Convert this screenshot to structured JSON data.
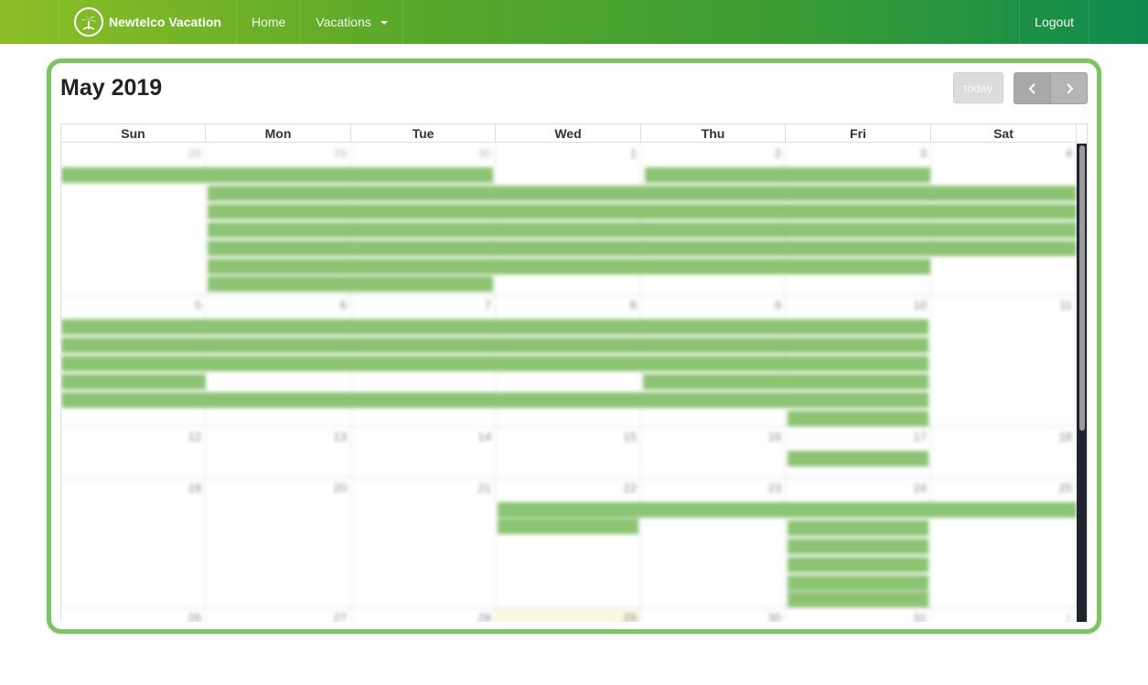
{
  "navbar": {
    "brand": "Newtelco Vacation",
    "items": [
      {
        "label": "Home"
      },
      {
        "label": "Vacations"
      }
    ],
    "logout": "Logout",
    "colors": {
      "start": "#8cbf26",
      "end": "#0e8a4e"
    }
  },
  "calendar": {
    "title": "May 2019",
    "today_label": "today",
    "prev_icon": "chevron-left-icon",
    "next_icon": "chevron-right-icon",
    "weekdays": [
      "Sun",
      "Mon",
      "Tue",
      "Wed",
      "Thu",
      "Fri",
      "Sat"
    ],
    "accent_color": "#82c266",
    "event_color": "#8cc474",
    "weeks": [
      {
        "days": [
          "28",
          "29",
          "30",
          "1",
          "2",
          "3",
          "4"
        ],
        "dim": [
          true,
          true,
          true,
          false,
          false,
          false,
          false
        ]
      },
      {
        "days": [
          "5",
          "6",
          "7",
          "8",
          "9",
          "10",
          "11"
        ],
        "dim": [
          false,
          false,
          false,
          false,
          false,
          false,
          false
        ]
      },
      {
        "days": [
          "12",
          "13",
          "14",
          "15",
          "16",
          "17",
          "18"
        ],
        "dim": [
          false,
          false,
          false,
          false,
          false,
          false,
          false
        ]
      },
      {
        "days": [
          "19",
          "20",
          "21",
          "22",
          "23",
          "24",
          "25"
        ],
        "dim": [
          false,
          false,
          false,
          false,
          false,
          false,
          false
        ]
      },
      {
        "days": [
          "26",
          "27",
          "28",
          "29",
          "30",
          "31",
          "1"
        ],
        "dim": [
          false,
          false,
          false,
          false,
          false,
          false,
          true
        ]
      }
    ]
  }
}
